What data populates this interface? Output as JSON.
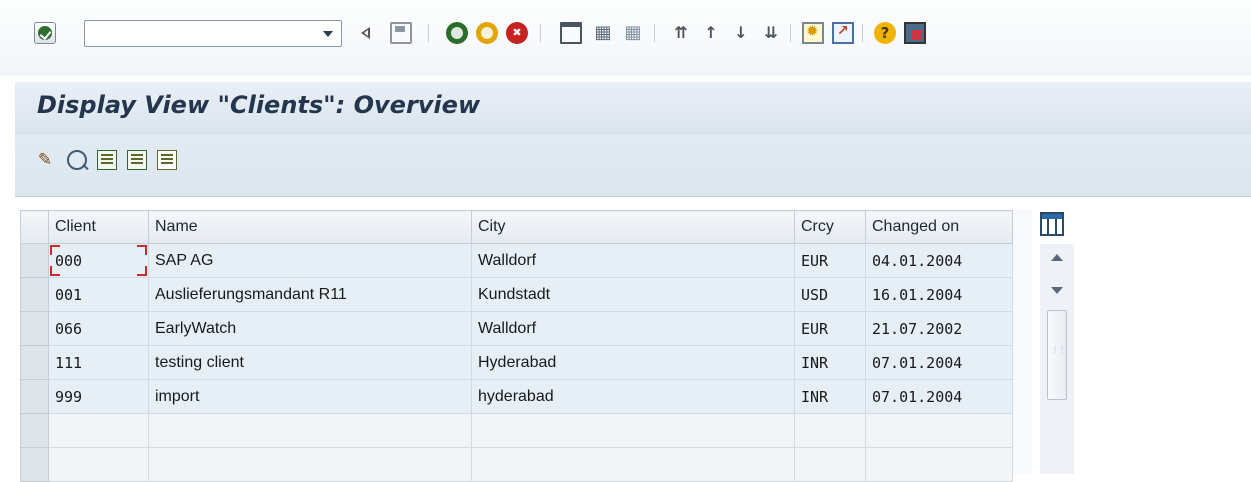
{
  "toolbar": {
    "command_field": {
      "value": "",
      "placeholder": ""
    },
    "icons": [
      "enter-icon",
      "back-icon",
      "save-icon",
      "exit-icon",
      "end-icon",
      "cancel-icon",
      "print-icon",
      "find-icon",
      "find-next-icon",
      "first-page-icon",
      "previous-page-icon",
      "next-page-icon",
      "last-page-icon",
      "create-session-icon",
      "create-shortcut-icon",
      "help-icon",
      "layout-menu-icon"
    ]
  },
  "title": "Display View \"Clients\": Overview",
  "app_toolbar": {
    "icons": [
      "display-change-icon",
      "details-icon",
      "select-all-icon",
      "select-block-icon",
      "deselect-all-icon"
    ]
  },
  "table": {
    "columns": [
      "Client",
      "Name",
      "City",
      "Crcy",
      "Changed on"
    ],
    "rows": [
      {
        "client": "000",
        "name": "SAP AG",
        "city": "Walldorf",
        "crcy": "EUR",
        "changed_on": "04.01.2004"
      },
      {
        "client": "001",
        "name": "Auslieferungsmandant R11",
        "city": "Kundstadt",
        "crcy": "USD",
        "changed_on": "16.01.2004"
      },
      {
        "client": "066",
        "name": "EarlyWatch",
        "city": "Walldorf",
        "crcy": "EUR",
        "changed_on": "21.07.2002"
      },
      {
        "client": "111",
        "name": "testing client",
        "city": "Hyderabad",
        "crcy": "INR",
        "changed_on": "07.01.2004"
      },
      {
        "client": "999",
        "name": "import",
        "city": "hyderabad",
        "crcy": "INR",
        "changed_on": "07.01.2004"
      }
    ]
  },
  "colors": {
    "title_text": "#23364d",
    "row_bg": "#e6eef6",
    "focus_border": "#cc2a2a"
  }
}
